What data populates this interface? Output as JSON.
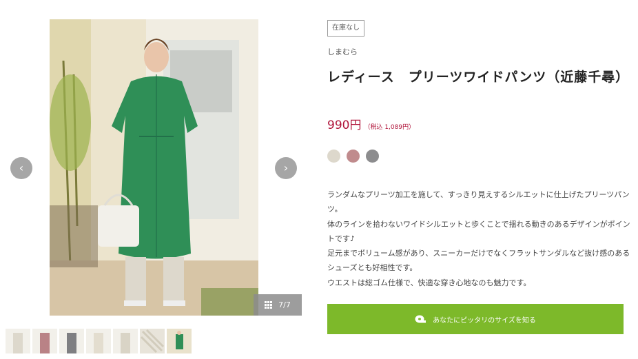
{
  "gallery": {
    "counter": "7/7",
    "prev_icon": "chevron-left-icon",
    "next_icon": "chevron-right-icon",
    "thumbnail_count": 7
  },
  "product": {
    "stock_badge": "在庫なし",
    "brand": "しまむら",
    "title": "レディース　プリーツワイドパンツ（近藤千尋）",
    "price": "990円",
    "price_tax": "（税込 1,089円）",
    "colors": [
      "#ddd8cc",
      "#c08b8d",
      "#8c8c8e"
    ],
    "description": [
      "ランダムなプリーツ加工を施して、すっきり見えするシルエットに仕上げたプリーツパンツ。",
      "体のラインを拾わないワイドシルエットと歩くことで揺れる動きのあるデザインがポイントです♪",
      "足元までボリューム感があり、スニーカーだけでなくフラットサンダルなど抜け感のあるシューズとも好相性です。",
      "ウエストは総ゴム仕様で、快適な穿き心地なのも魅力です。"
    ],
    "fit_button": "あなたにピッタリのサイズを知る",
    "accent_color": "#7db92a",
    "price_color": "#b0143a"
  }
}
